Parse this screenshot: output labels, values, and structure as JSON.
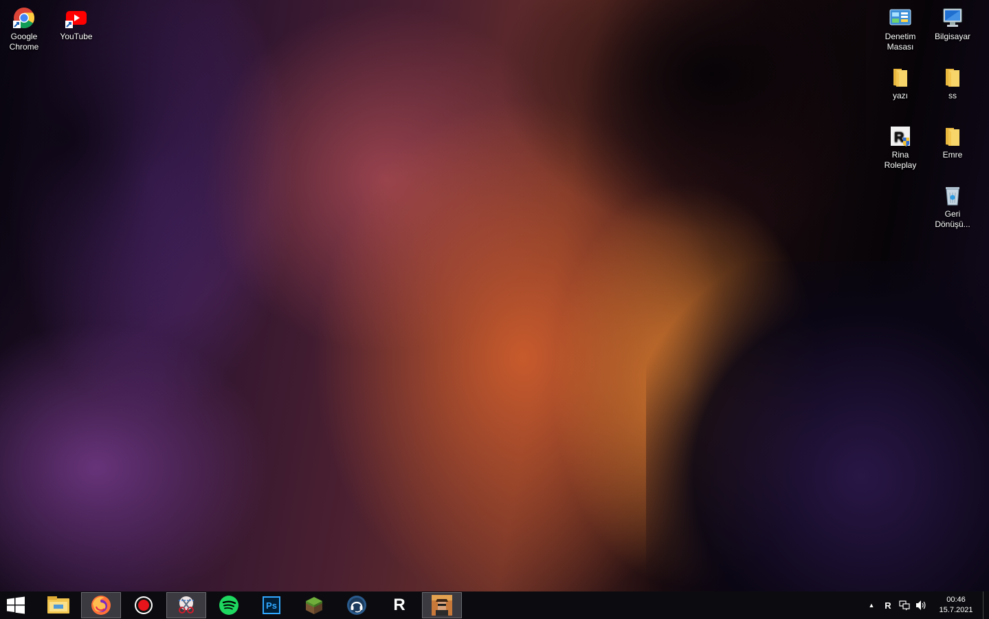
{
  "desktop": {
    "icons_left": [
      {
        "label_1": "Google",
        "label_2": "Chrome"
      },
      {
        "label_1": "YouTube"
      }
    ],
    "icons_right": [
      {
        "label_1": "Denetim",
        "label_2": "Masası"
      },
      {
        "label_1": "Bilgisayar"
      },
      {
        "label_1": "yazı"
      },
      {
        "label_1": "ss"
      },
      {
        "label_1": "Rina Roleplay"
      },
      {
        "label_1": "Emre"
      },
      {
        "label_1": "Geri",
        "label_2": "Dönüşü..."
      }
    ]
  },
  "taskbar": {
    "pinned": [
      {
        "name": "file-explorer",
        "icon": "folder-icon"
      },
      {
        "name": "firefox",
        "icon": "firefox-icon",
        "active": true
      },
      {
        "name": "screen-recorder",
        "icon": "record-icon"
      },
      {
        "name": "snipping-tool",
        "icon": "scissors-icon",
        "active": true
      },
      {
        "name": "spotify",
        "icon": "spotify-icon"
      },
      {
        "name": "photoshop",
        "icon": "photoshop-icon",
        "text": "Ps"
      },
      {
        "name": "minecraft",
        "icon": "grass-block-icon"
      },
      {
        "name": "teamspeak",
        "icon": "headset-icon"
      },
      {
        "name": "rockstar-launcher",
        "icon": "r-letter-icon",
        "text": "R"
      },
      {
        "name": "game-window",
        "icon": "game-thumbnail-icon",
        "active": true
      }
    ],
    "tray": {
      "overflow": "▲",
      "language": "R",
      "time": "00:46",
      "date": "15.7.2021"
    }
  },
  "colors": {
    "taskbar_bg": "#0c0c10",
    "active_button_bg": "#3a3a40",
    "folder_yellow": "#f3c64f",
    "spotify_green": "#1ed760",
    "photoshop_blue": "#31a8ff"
  }
}
